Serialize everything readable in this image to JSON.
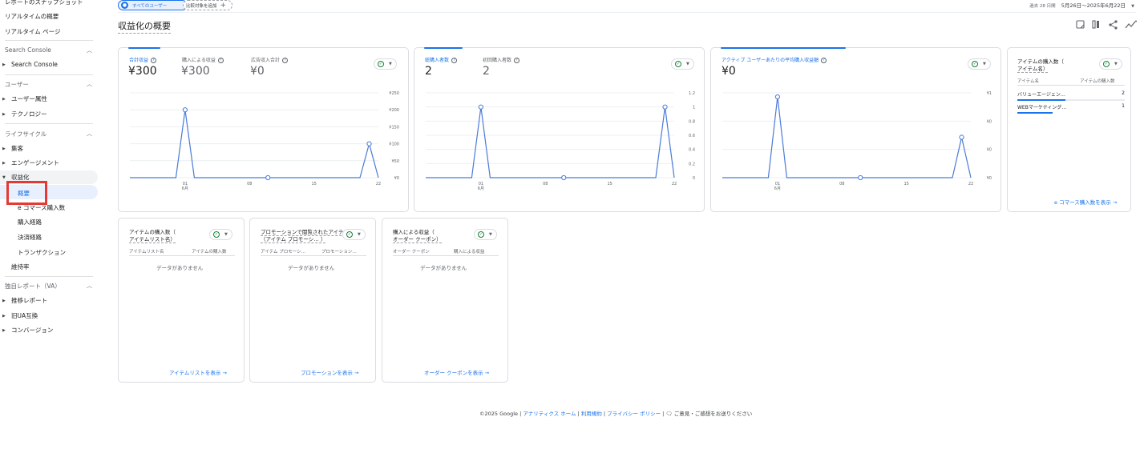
{
  "sidebar": {
    "top_items": [
      "レポートのスナップショット",
      "リアルタイムの概要",
      "リアルタイム ページ"
    ],
    "sections": [
      {
        "title": "Search Console",
        "items": [
          "Search Console"
        ]
      },
      {
        "title": "ユーザー",
        "items": [
          "ユーザー属性",
          "テクノロジー"
        ]
      },
      {
        "title": "ライフサイクル",
        "items": [
          "集客",
          "エンゲージメント",
          "収益化"
        ]
      },
      {
        "title": "独自レポート（VA）",
        "items": [
          "推移レポート",
          "旧UA互換",
          "コンバージョン"
        ]
      }
    ],
    "monetization_sub": [
      "概要",
      "e コマース購入数",
      "購入経路",
      "決済経路",
      "トランザクション"
    ],
    "retention": "維持率"
  },
  "header": {
    "segment_chip": "すべてのユーザー",
    "add_comparison": "比較対象を追加",
    "date_prefix": "過去 28 日間",
    "date_range": "5月26日～2025年6月22日",
    "page_title": "収益化の概要"
  },
  "cards": {
    "revenue": {
      "metrics": [
        {
          "label": "合計収益",
          "value": "¥300"
        },
        {
          "label": "購入による収益",
          "value": "¥300"
        },
        {
          "label": "広告収入合計",
          "value": "¥0"
        }
      ],
      "y_ticks": [
        "¥250",
        "¥200",
        "¥150",
        "¥100",
        "¥50",
        "¥0"
      ],
      "x_ticks": [
        "01",
        "08",
        "15",
        "22"
      ],
      "x_month": "6月"
    },
    "purchasers": {
      "metrics": [
        {
          "label": "総購入者数",
          "value": "2"
        },
        {
          "label": "初回購入者数",
          "value": "2"
        }
      ],
      "y_ticks": [
        "1.2",
        "1",
        "0.8",
        "0.6",
        "0.4",
        "0.2",
        "0"
      ],
      "x_ticks": [
        "01",
        "08",
        "15",
        "22"
      ],
      "x_month": "6月"
    },
    "arppu": {
      "metrics": [
        {
          "label": "アクティブ ユーザーあたりの平均購入収益額",
          "value": "¥0"
        }
      ],
      "y_ticks": [
        "¥1",
        "¥0",
        "¥0",
        "¥0"
      ],
      "x_ticks": [
        "01",
        "08",
        "15",
        "22"
      ],
      "x_month": "6月"
    },
    "item_purchases": {
      "title_line1": "アイテムの購入数（",
      "title_line2": "アイテム名）",
      "col1": "アイテム名",
      "col2": "アイテムの購入数",
      "rows": [
        {
          "name": "バリューエージェン…",
          "value": "2"
        },
        {
          "name": "WEBマーケティング…",
          "value": "1"
        }
      ],
      "link": "e コマース購入数を表示"
    },
    "item_list": {
      "title_line1": "アイテムの購入数（",
      "title_line2": "アイテムリスト名）",
      "col1": "アイテムリスト名",
      "col2": "アイテムの購入数",
      "nodata": "データがありません",
      "link": "アイテムリストを表示"
    },
    "promotion": {
      "title_line1": "プロモーションで閲覧されたアイテム数",
      "title_line2": "（アイテム プロモーシ… ）",
      "col1": "アイテム プロモーシ…",
      "col2": "プロモーション…",
      "nodata": "データがありません",
      "link": "プロモーションを表示"
    },
    "coupon": {
      "title_line1": "購入による収益（",
      "title_line2": "オーダー クーポン）",
      "col1": "オーダー クーポン",
      "col2": "購入による収益",
      "nodata": "データがありません",
      "link": "オーダー クーポンを表示"
    }
  },
  "chart_data": [
    {
      "type": "line",
      "x": [
        "05-26",
        "05-27",
        "05-28",
        "05-29",
        "05-30",
        "05-31",
        "06-01",
        "06-02",
        "06-03",
        "06-04",
        "06-05",
        "06-06",
        "06-07",
        "06-08",
        "06-09",
        "06-10",
        "06-11",
        "06-12",
        "06-13",
        "06-14",
        "06-15",
        "06-16",
        "06-17",
        "06-18",
        "06-19",
        "06-20",
        "06-21",
        "06-22"
      ],
      "values": [
        0,
        0,
        0,
        0,
        0,
        0,
        200,
        0,
        0,
        0,
        0,
        0,
        0,
        0,
        0,
        0,
        0,
        0,
        0,
        0,
        0,
        0,
        0,
        0,
        0,
        0,
        100,
        0
      ],
      "ylim": [
        0,
        250
      ]
    },
    {
      "type": "line",
      "x": [
        "05-26",
        "05-27",
        "05-28",
        "05-29",
        "05-30",
        "05-31",
        "06-01",
        "06-02",
        "06-03",
        "06-04",
        "06-05",
        "06-06",
        "06-07",
        "06-08",
        "06-09",
        "06-10",
        "06-11",
        "06-12",
        "06-13",
        "06-14",
        "06-15",
        "06-16",
        "06-17",
        "06-18",
        "06-19",
        "06-20",
        "06-21",
        "06-22"
      ],
      "values": [
        0,
        0,
        0,
        0,
        0,
        0,
        1,
        0,
        0,
        0,
        0,
        0,
        0,
        0,
        0,
        0,
        0,
        0,
        0,
        0,
        0,
        0,
        0,
        0,
        0,
        0,
        1,
        0
      ],
      "ylim": [
        0,
        1.2
      ]
    },
    {
      "type": "line",
      "x": [
        "05-26",
        "05-27",
        "05-28",
        "05-29",
        "05-30",
        "05-31",
        "06-01",
        "06-02",
        "06-03",
        "06-04",
        "06-05",
        "06-06",
        "06-07",
        "06-08",
        "06-09",
        "06-10",
        "06-11",
        "06-12",
        "06-13",
        "06-14",
        "06-15",
        "06-16",
        "06-17",
        "06-18",
        "06-19",
        "06-20",
        "06-21",
        "06-22"
      ],
      "values": [
        0,
        0,
        0,
        0,
        0,
        0,
        1,
        0,
        0,
        0,
        0,
        0,
        0,
        0,
        0,
        0,
        0,
        0,
        0,
        0,
        0,
        0,
        0,
        0,
        0,
        0,
        0.5,
        0
      ],
      "ylim": [
        0,
        1.05
      ]
    }
  ],
  "footer": {
    "copyright": "©2025 Google",
    "links": [
      "アナリティクス ホーム",
      "利用規約",
      "プライバシー ポリシー"
    ],
    "feedback": "ご意見・ご感想をお送りください"
  }
}
